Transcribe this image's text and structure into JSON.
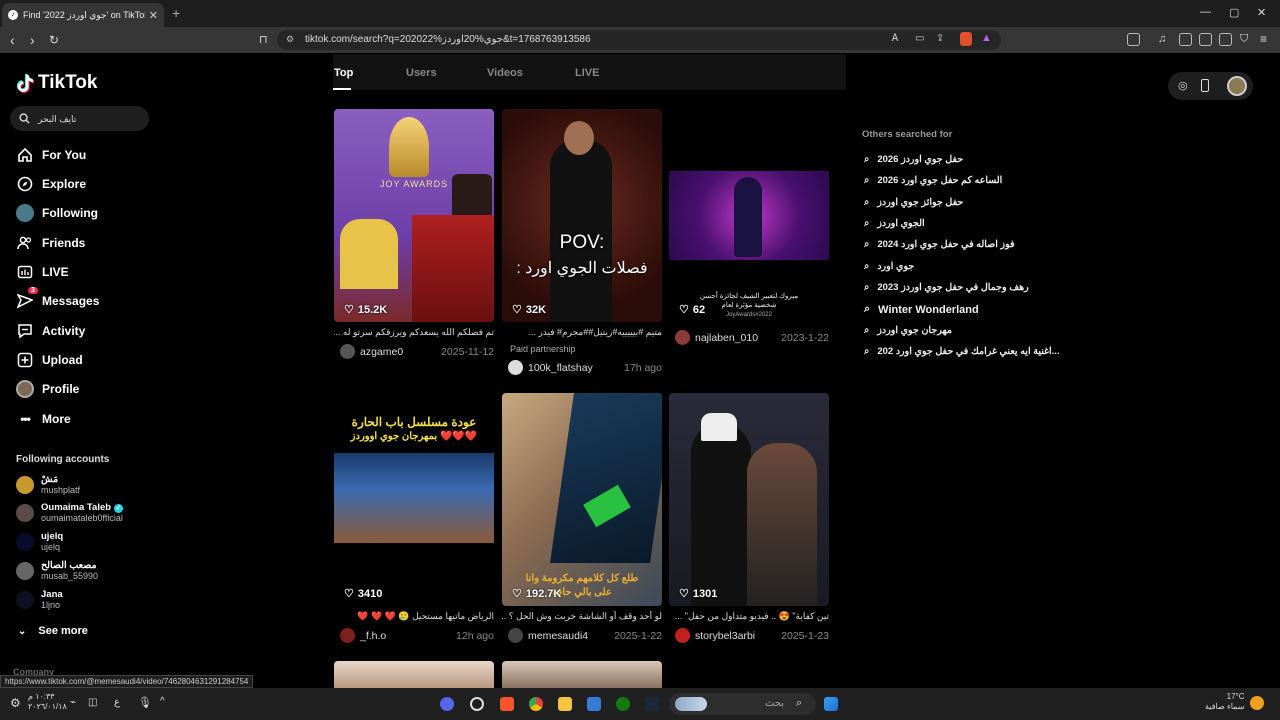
{
  "browser": {
    "tab_title": "Find '2022 جوي اوردز' on TikTok",
    "url": "tiktok.com/search?q=202022%جوي%20اوردز&t=1768763913586"
  },
  "sidebar": {
    "logo": "TikTok",
    "search_value": "تايف البحر",
    "nav": [
      {
        "label": "For You",
        "icon": "home-icon"
      },
      {
        "label": "Explore",
        "icon": "compass-icon"
      },
      {
        "label": "Following",
        "icon": "following-avatar-icon"
      },
      {
        "label": "Friends",
        "icon": "friends-icon"
      },
      {
        "label": "LIVE",
        "icon": "live-icon"
      },
      {
        "label": "Messages",
        "icon": "messages-icon",
        "badge": "3"
      },
      {
        "label": "Activity",
        "icon": "activity-icon"
      },
      {
        "label": "Upload",
        "icon": "upload-icon"
      },
      {
        "label": "Profile",
        "icon": "profile-avatar-icon"
      },
      {
        "label": "More",
        "icon": "more-icon"
      }
    ],
    "following_title": "Following accounts",
    "accounts": [
      {
        "name": "مَشْ",
        "handle": "mushplatf"
      },
      {
        "name": "Oumaima Taleb",
        "handle": "oumaimataleb0fficial",
        "verified": true
      },
      {
        "name": "ujelq",
        "handle": "ujelq"
      },
      {
        "name": "مصعب الصالح",
        "handle": "musab_55990"
      },
      {
        "name": "Jana",
        "handle": "1ljno"
      }
    ],
    "see_more": "See more",
    "company": "Company"
  },
  "search_tabs": [
    "Top",
    "Users",
    "Videos",
    "LIVE"
  ],
  "results": [
    {
      "likes": "15.2K",
      "desc": "تم فضلكم الله يسعدكم ويرزقكم سرتو له ...",
      "user": "azgame0",
      "date": "2025-11-12"
    },
    {
      "likes": "32K",
      "desc": "متيم #بيييييه#ريتيل##مجرم# فيدر ...",
      "paid": "Paid partnership",
      "user": "100k_flatshay",
      "date": "17h ago",
      "overlay1": "POV:",
      "overlay2": "فصلات الجوي اورد :"
    },
    {
      "likes": "62",
      "desc": "",
      "user": "najlaben_010",
      "date": "2023-1-22",
      "caption": "مبروك لتعبير الشيف لجائزة أحسن شخصية مؤثرة لعام",
      "tag": "JoyAwards#2022"
    },
    {
      "likes": "3410",
      "desc": "الرياض ماتيها مستحيل 🥲 ❤️ ❤️ ❤️",
      "user": "_f.h.o",
      "date": "12h ago",
      "overlay1": "عودة مسلسل باب الحارة",
      "overlay2": "بمهرجان جوي اووردز ❤️❤️❤️"
    },
    {
      "likes": "192.7K",
      "desc": "لو أحد وقف أو الشاشة خربت وش الحل ؟ ...",
      "user": "memesaudi4",
      "date": "2025-1-22",
      "overlay1": "طلع كل كلامهم مكرومة وانا",
      "overlay2": "على بالي حافة"
    },
    {
      "likes": "1301",
      "desc": "تين كفاية\" 😍 .. فيديو متداول من حفل\" ...",
      "user": "storybel3arbi",
      "date": "2025-1-23"
    }
  ],
  "others": {
    "title": "Others searched for",
    "items": [
      "حفل جوي اوردز 2026",
      "الساعه كم حفل جوي اورد 2026",
      "حفل جوائز جوي اوردز",
      "الجوي اوردز",
      "فوز اصاله في حفل جوي اورد 2024",
      "جوي اورد",
      "رهف وجمال في حفل جوي اوردز 2023",
      "Winter Wonderland",
      "مهرجان جوي اوردز",
      "اغنية ايه يعني غرامك في حفل جوي اورد 202..."
    ]
  },
  "status_url": "https://www.tiktok.com/@memesaudi4/video/7462804631291284754",
  "taskbar": {
    "time": "١٠:٣٣ م",
    "date": "٢٠٢٦/٠١/١٨",
    "search_placeholder": "بحث",
    "temp": "17°C",
    "weather": "سماء صافية"
  }
}
